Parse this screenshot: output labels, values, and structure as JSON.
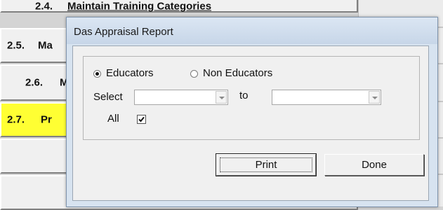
{
  "background_menu": {
    "items": [
      {
        "number": "2.4.",
        "label": "Maintain Training Categories",
        "active": false
      },
      {
        "number": "2.5.",
        "label": "Ma",
        "active": false
      },
      {
        "number": "2.6.",
        "label": "M",
        "active": false
      },
      {
        "number": "2.7.",
        "label": "Pr",
        "active": false
      },
      {
        "number": "",
        "label": "",
        "active": false
      }
    ],
    "active_color": "#ffff33"
  },
  "dialog": {
    "title": "Das Appraisal Report",
    "radio_educators": {
      "label": "Educators",
      "selected": true
    },
    "radio_non_educators": {
      "label": "Non Educators",
      "selected": false
    },
    "select_label": "Select",
    "from_value": "",
    "to_label": "to",
    "to_value": "",
    "all_label": "All",
    "all_checked": true,
    "print_button": "Print",
    "done_button": "Done"
  }
}
